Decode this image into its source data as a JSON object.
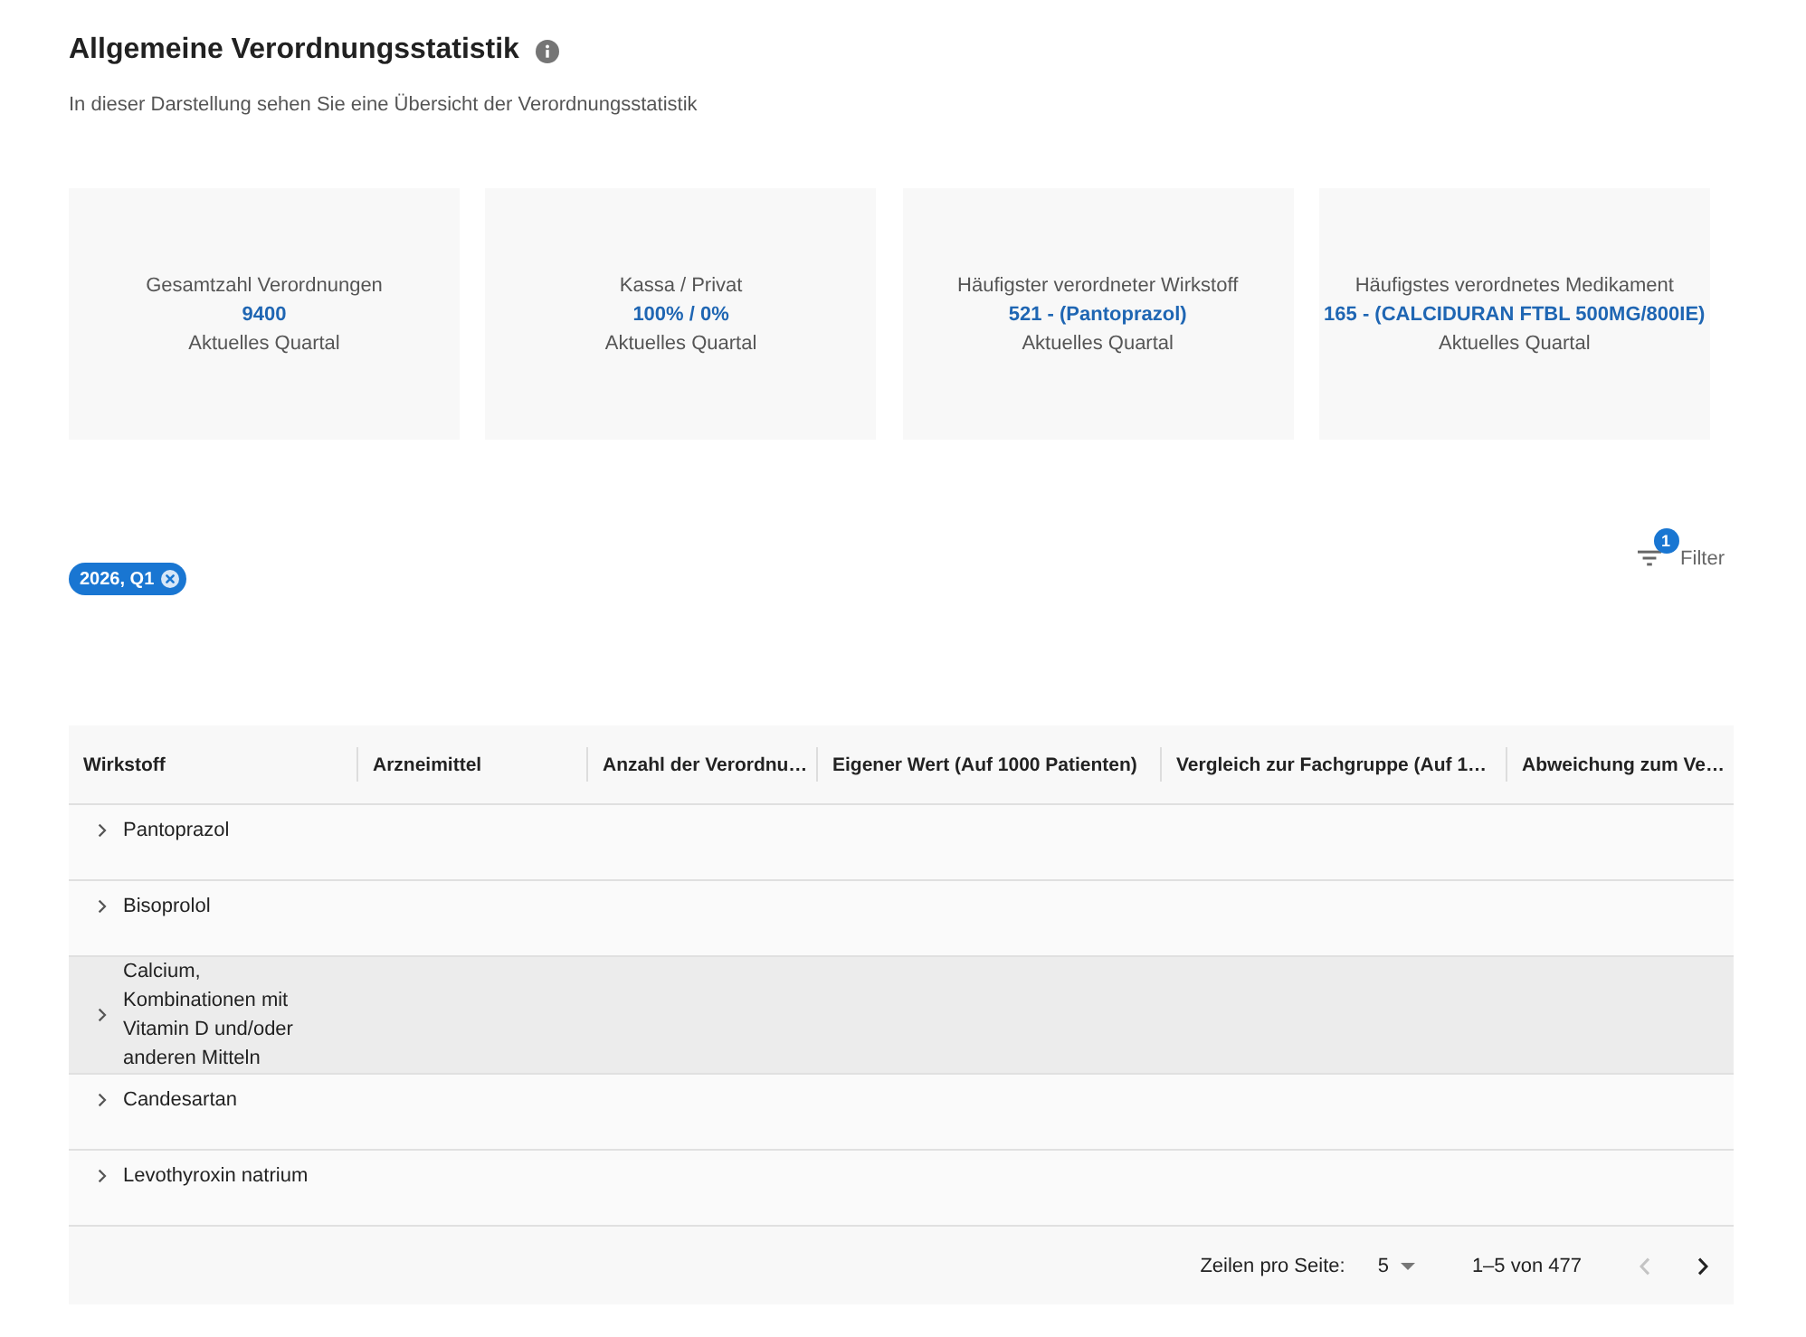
{
  "header": {
    "title": "Allgemeine Verordnungsstatistik",
    "subtitle": "In dieser Darstellung sehen Sie eine Übersicht der Verordnungsstatistik"
  },
  "cards": [
    {
      "label": "Gesamtzahl Verordnungen",
      "value": "9400",
      "period": "Aktuelles Quartal"
    },
    {
      "label": "Kassa / Privat",
      "value": "100% / 0%",
      "period": "Aktuelles Quartal"
    },
    {
      "label": "Häufigster verordneter Wirkstoff",
      "value": "521 - (Pantoprazol)",
      "period": "Aktuelles Quartal"
    },
    {
      "label": "Häufigstes verordnetes Medikament",
      "value": "165 - (CALCIDURAN FTBL 500MG/800IE)",
      "period": "Aktuelles Quartal"
    }
  ],
  "filter_chips": [
    {
      "label": "2026, Q1"
    }
  ],
  "filter_button": {
    "label": "Filter",
    "badge": "1"
  },
  "table": {
    "columns": [
      "Wirkstoff",
      "Arzneimittel",
      "Anzahl der Verordnu…",
      "Eigener Wert (Auf 1000 Patienten)",
      "Vergleich zur Fachgruppe (Auf 1…",
      "Abweichung zum Ve…"
    ],
    "rows": [
      {
        "wirkstoff": "Pantoprazol",
        "expanded": false,
        "hovered": false
      },
      {
        "wirkstoff": "Bisoprolol",
        "expanded": false,
        "hovered": false
      },
      {
        "wirkstoff": "Calcium, Kombinationen mit Vitamin D und/oder anderen Mitteln",
        "expanded": false,
        "hovered": true
      },
      {
        "wirkstoff": "Candesartan",
        "expanded": false,
        "hovered": false
      },
      {
        "wirkstoff": "Levothyroxin natrium",
        "expanded": false,
        "hovered": false
      }
    ]
  },
  "pagination": {
    "rows_per_page_label": "Zeilen pro Seite:",
    "rows_per_page": "5",
    "range": "1–5 von 477",
    "previous_disabled": true,
    "next_disabled": false
  }
}
